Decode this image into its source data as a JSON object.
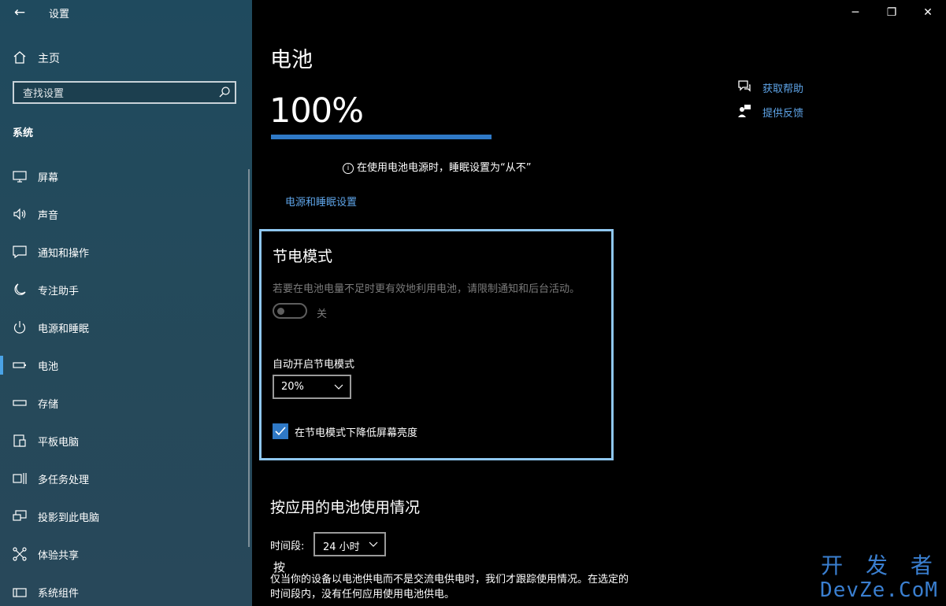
{
  "window": {
    "title": "设置",
    "minimize": "─",
    "restore": "❐",
    "close": "✕"
  },
  "sidebar": {
    "home": "主页",
    "search_placeholder": "查找设置",
    "section": "系统",
    "items": [
      {
        "label": "屏幕",
        "icon": "monitor-icon"
      },
      {
        "label": "声音",
        "icon": "speaker-icon"
      },
      {
        "label": "通知和操作",
        "icon": "notification-icon"
      },
      {
        "label": "专注助手",
        "icon": "moon-icon"
      },
      {
        "label": "电源和睡眠",
        "icon": "power-icon"
      },
      {
        "label": "电池",
        "icon": "battery-icon",
        "active": true
      },
      {
        "label": "存储",
        "icon": "storage-icon"
      },
      {
        "label": "平板电脑",
        "icon": "tablet-icon"
      },
      {
        "label": "多任务处理",
        "icon": "multitask-icon"
      },
      {
        "label": "投影到此电脑",
        "icon": "project-icon"
      },
      {
        "label": "体验共享",
        "icon": "share-icon"
      },
      {
        "label": "系统组件",
        "icon": "components-icon"
      }
    ]
  },
  "main": {
    "title": "电池",
    "battery_percent": "100%",
    "battery_level": 1.0,
    "sleep_note": "在使用电池电源时，睡眠设置为“从不”",
    "power_link": "电源和睡眠设置",
    "help": {
      "get_help": "获取帮助",
      "feedback": "提供反馈"
    },
    "saver": {
      "title": "节电模式",
      "description": "若要在电池电量不足时更有效地利用电池，请限制通知和后台活动。",
      "toggle_state": "关",
      "auto_label": "自动开启节电模式",
      "threshold": "20%",
      "checkbox_label": "在节电模式下降低屏幕亮度"
    },
    "usage": {
      "title": "按应用的电池使用情况",
      "period_label": "时间段:",
      "period": "24 小时",
      "fragment": "按",
      "note": "仅当你的设备以电池供电而不是交流电供电时，我们才跟踪使用情况。在选定的时间段内，没有任何应用使用电池供电。"
    }
  },
  "watermark": {
    "line1": "开 发 者",
    "line2": "DevZe.CoM"
  },
  "colors": {
    "accent": "#2f79c6",
    "link": "#5ea4e8",
    "highlight_border": "#8fc7ef"
  }
}
